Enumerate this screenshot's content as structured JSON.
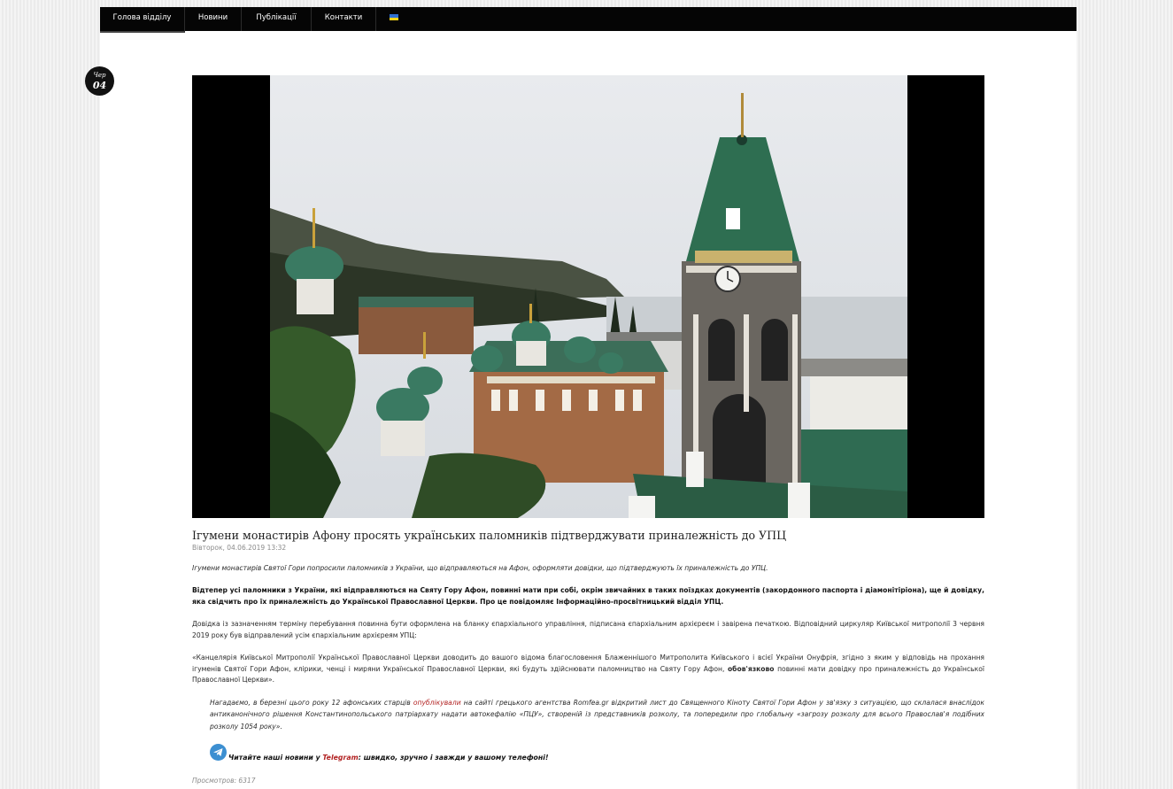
{
  "nav": {
    "items": [
      {
        "label": "Голова відділу"
      },
      {
        "label": "Новини"
      },
      {
        "label": "Публікації"
      },
      {
        "label": "Контакти"
      }
    ],
    "flag_icon": "ukraine-flag-icon"
  },
  "date_badge": {
    "month": "Чер",
    "day": "04"
  },
  "article": {
    "title": "Ігумени монастирів Афону просять українських паломників підтверджувати приналежність до УПЦ",
    "date": "Вівторок, 04.06.2019 13:32",
    "lead": "Ігумени монастирів Святої Гори попросили паломників з України, що відправляються на Афон, оформляти довідки, що підтверджують їх приналежність до УПЦ.",
    "bold_paragraph": "Відтепер усі паломники з України, які відправляються на Святу Гору Афон, повинні мати при собі, окрім звичайних в таких поїздках документів (закордонного паспорта і діамонітіріона), ще й довідку, яка свідчить про їх приналежність до Української Православної Церкви. Про це повідомляє Інформаційно-просвітницький відділ УПЦ.",
    "paragraph_2": "Довідка із зазначенням терміну перебування повинна бути оформлена на бланку єпархіального управління, підписана єпархіальним архієреєм і завірена печаткою. Відповідний циркуляр Київської митрополії 3 червня 2019 року був відправлений усім єпархіальним архієреям УПЦ:",
    "paragraph_3_a": "«Канцелярія Київської Митрополії Української Православної Церкви доводить до вашого відома благословення Блаженнішого Митрополита Київського і всієї України Онуфрія, згідно з яким у відповідь на прохання ігуменів Святої Гори Афон, клірики, ченці і миряни Української Православної Церкви, які будуть здійснювати паломництво на Святу Гору Афон, ",
    "paragraph_3_bold": "обов'язково",
    "paragraph_3_b": " повинні мати довідку про приналежність до Української Православної Церкви».",
    "quote_a": "Нагадаємо, в березні цього року 12 афонських старців ",
    "quote_link": "опублікували",
    "quote_b": " на сайті грецького агентства Romfea.gr відкритий лист до Священного Кіноту Святої Гори Афон у зв'язку з ситуацією, що склалася внаслідок антиканонічного рішення Константинопольського патріархату надати автокефалію «ПЦУ», створеній із представників розколу, та попередили про глобальну «загрозу розколу для всього Православ'я подібних розколу 1054 року».",
    "telegram_a": "Читайте наші новини у ",
    "telegram_link": "Telegram",
    "telegram_b": ": швидко, зручно і завжди у вашому телефоні!",
    "telegram_icon": "telegram-icon",
    "views": "Просмотров: 6317"
  },
  "colors": {
    "navbar": "#050505",
    "link": "#b22222"
  }
}
